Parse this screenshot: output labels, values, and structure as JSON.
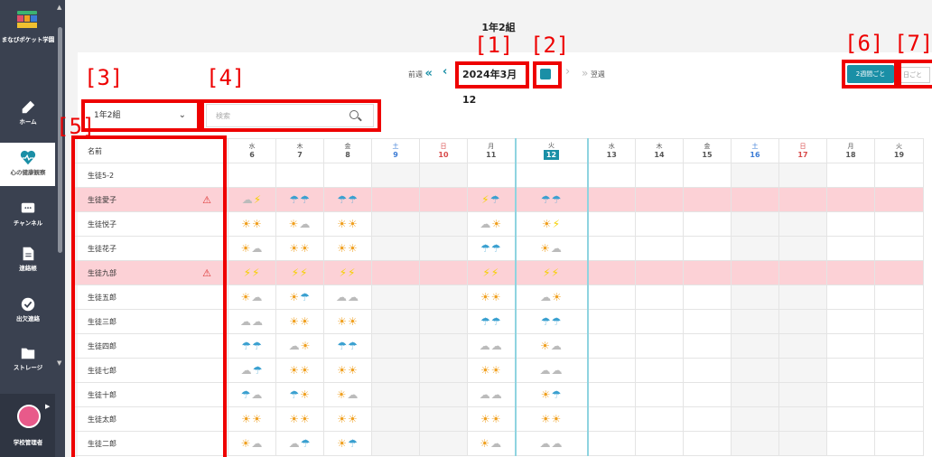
{
  "sidebar": {
    "school_name": "まなびポケット学園",
    "items": [
      {
        "label": "ホーム",
        "icon": "pencil-icon"
      },
      {
        "label": "心の健康観察",
        "icon": "heart-pulse-icon"
      },
      {
        "label": "チャンネル",
        "icon": "chat-icon"
      },
      {
        "label": "連絡帳",
        "icon": "notebook-icon"
      },
      {
        "label": "出欠連絡",
        "icon": "check-icon"
      },
      {
        "label": "ストレージ",
        "icon": "folder-icon"
      }
    ],
    "user_role": "学校管理者"
  },
  "page_title": "1年2組",
  "date_nav": {
    "prev_label": "前週",
    "next_label": "翌週",
    "current_date": "2024年3月12"
  },
  "view_buttons": {
    "two_weeks": "2週間ごと",
    "daily": "日ごと"
  },
  "class_select": {
    "value": "1年2組"
  },
  "search": {
    "placeholder": "検索"
  },
  "annotations": [
    "[1]",
    "[2]",
    "[3]",
    "[4]",
    "[5]",
    "[6]",
    "[7]"
  ],
  "table": {
    "name_header": "名前",
    "days": [
      {
        "dow": "水",
        "day": "6"
      },
      {
        "dow": "木",
        "day": "7"
      },
      {
        "dow": "金",
        "day": "8"
      },
      {
        "dow": "土",
        "day": "9"
      },
      {
        "dow": "日",
        "day": "10"
      },
      {
        "dow": "月",
        "day": "11"
      },
      {
        "dow": "火",
        "day": "12"
      },
      {
        "dow": "水",
        "day": "13"
      },
      {
        "dow": "木",
        "day": "14"
      },
      {
        "dow": "金",
        "day": "15"
      },
      {
        "dow": "土",
        "day": "16"
      },
      {
        "dow": "日",
        "day": "17"
      },
      {
        "dow": "月",
        "day": "18"
      },
      {
        "dow": "火",
        "day": "19"
      }
    ],
    "students": [
      {
        "name": "生徒5-2",
        "alert": false,
        "weather": [
          "",
          "",
          "",
          "",
          "",
          "",
          ""
        ]
      },
      {
        "name": "生徒愛子",
        "alert": true,
        "weather": [
          "☁⚡",
          "☂☂",
          "☂☂",
          "",
          "",
          "⚡☂",
          "☂☂"
        ]
      },
      {
        "name": "生徒悦子",
        "alert": false,
        "weather": [
          "☀☀",
          "☀☁",
          "☀☀",
          "",
          "",
          "☁☀",
          "☀⚡"
        ]
      },
      {
        "name": "生徒花子",
        "alert": false,
        "weather": [
          "☀☁",
          "☀☀",
          "☀☀",
          "",
          "",
          "☂☂",
          "☀☁"
        ]
      },
      {
        "name": "生徒九部",
        "alert": true,
        "weather": [
          "⚡⚡",
          "⚡⚡",
          "⚡⚡",
          "",
          "",
          "⚡⚡",
          "⚡⚡"
        ]
      },
      {
        "name": "生徒五郎",
        "alert": false,
        "weather": [
          "☀☁",
          "☀☂",
          "☁☁",
          "",
          "",
          "☀☀",
          "☁☀"
        ]
      },
      {
        "name": "生徒三郎",
        "alert": false,
        "weather": [
          "☁☁",
          "☀☀",
          "☀☀",
          "",
          "",
          "☂☂",
          "☂☂"
        ]
      },
      {
        "name": "生徒四郎",
        "alert": false,
        "weather": [
          "☂☂",
          "☁☀",
          "☂☂",
          "",
          "",
          "☁☁",
          "☀☁"
        ]
      },
      {
        "name": "生徒七郎",
        "alert": false,
        "weather": [
          "☁☂",
          "☀☀",
          "☀☀",
          "",
          "",
          "☀☀",
          "☁☁"
        ]
      },
      {
        "name": "生徒十郎",
        "alert": false,
        "weather": [
          "☂☁",
          "☂☀",
          "☀☁",
          "",
          "",
          "☁☁",
          "☀☂"
        ]
      },
      {
        "name": "生徒太郎",
        "alert": false,
        "weather": [
          "☀☀",
          "☀☀",
          "☀☀",
          "",
          "",
          "☀☀",
          "☀☀"
        ]
      },
      {
        "name": "生徒二郎",
        "alert": false,
        "weather": [
          "☀☁",
          "☁☂",
          "☀☂",
          "",
          "",
          "☀☁",
          "☁☁"
        ]
      }
    ]
  },
  "colors": {
    "accent": "#1a8fa6",
    "alert_row": "#fcd1d6",
    "annotation": "#e00000",
    "sidebar": "#3a4150"
  }
}
